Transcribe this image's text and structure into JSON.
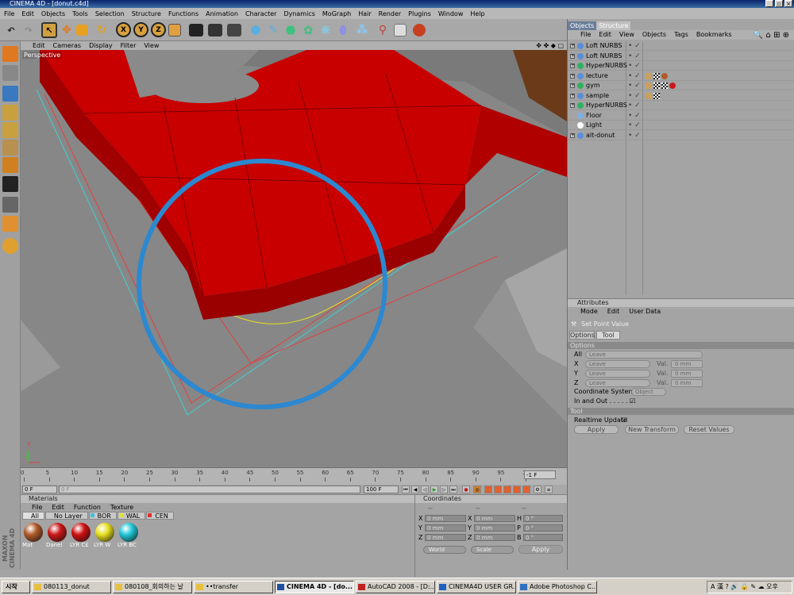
{
  "window": {
    "title": "CINEMA 4D - [donut.c4d]"
  },
  "menu": [
    "File",
    "Edit",
    "Objects",
    "Tools",
    "Selection",
    "Structure",
    "Functions",
    "Animation",
    "Character",
    "Dynamics",
    "MoGraph",
    "Hair",
    "Render",
    "Plugins",
    "Window",
    "Help"
  ],
  "toolbar": {
    "x_label": "X",
    "y_label": "Y",
    "z_label": "Z"
  },
  "viewport": {
    "menu": [
      "Edit",
      "Cameras",
      "Display",
      "Filter",
      "View"
    ],
    "label": "Perspective",
    "icons": "✥ ✤ ◆ ▢"
  },
  "timeline": {
    "ticks": [
      "0",
      "5",
      "10",
      "15",
      "20",
      "25",
      "30",
      "35",
      "40",
      "45",
      "50",
      "55",
      "60",
      "65",
      "70",
      "75",
      "80",
      "85",
      "90",
      "95",
      "100"
    ],
    "end_label": "-1 F",
    "start_field": "0 F",
    "current_field": "0 F",
    "max_field": "100 F",
    "end_field": "100 F"
  },
  "materials": {
    "title": "Materials",
    "menu": [
      "File",
      "Edit",
      "Function",
      "Texture"
    ],
    "tabs": [
      {
        "label": "All",
        "color": ""
      },
      {
        "label": "No Layer",
        "color": ""
      },
      {
        "label": "BOR",
        "color": "#40c0e0"
      },
      {
        "label": "WAL",
        "color": "#e0e040"
      },
      {
        "label": "CEN",
        "color": "#e03030"
      }
    ],
    "items": [
      {
        "label": "Mat",
        "color": "#b05a28"
      },
      {
        "label": "Danel",
        "color": "#cc1818"
      },
      {
        "label": "LYR C£",
        "color": "#d01010"
      },
      {
        "label": "LYR W",
        "color": "#e8e020"
      },
      {
        "label": "LYR BC",
        "color": "#20c8d8"
      }
    ]
  },
  "coordinates": {
    "title": "Coordinates",
    "headers": [
      "--",
      "--",
      "--"
    ],
    "rows": [
      {
        "axis": "X",
        "pos": "0 mm",
        "size_axis": "X",
        "size": "0 mm",
        "rot_axis": "H",
        "rot": "0 °"
      },
      {
        "axis": "Y",
        "pos": "0 mm",
        "size_axis": "Y",
        "size": "0 mm",
        "rot_axis": "P",
        "rot": "0 °"
      },
      {
        "axis": "Z",
        "pos": "0 mm",
        "size_axis": "Z",
        "size": "0 mm",
        "rot_axis": "B",
        "rot": "0 °"
      }
    ],
    "mode1": "World",
    "mode2": "Scale",
    "apply": "Apply"
  },
  "objects": {
    "tabs": [
      "Objects",
      "Structure"
    ],
    "menu": [
      "File",
      "Edit",
      "View",
      "Objects",
      "Tags",
      "Bookmarks"
    ],
    "icons": "🔍 ⌂ ⊞ ⊕",
    "rows": [
      {
        "name": "Loft NURBS",
        "icon": "#5b8dd8",
        "exp": "+",
        "tags": []
      },
      {
        "name": "Loft NURBS",
        "icon": "#5b8dd8",
        "exp": "+",
        "tags": []
      },
      {
        "name": "HyperNURBS",
        "icon": "#30b060",
        "exp": "+",
        "tags": []
      },
      {
        "name": "lecture",
        "icon": "#5b8dd8",
        "exp": "+",
        "tags": [
          "ph",
          "tex",
          "mat:#b05a28"
        ]
      },
      {
        "name": "gym",
        "icon": "#30b060",
        "exp": "+",
        "tags": [
          "ph",
          "tex",
          "tex",
          "mat:#cc1818"
        ]
      },
      {
        "name": "sample",
        "icon": "#5b8dd8",
        "exp": "+",
        "tags": [
          "ph",
          "tex"
        ]
      },
      {
        "name": "HyperNURBS",
        "icon": "#30b060",
        "exp": "+",
        "tags": []
      },
      {
        "name": "Floor",
        "icon": "#7fb0e0",
        "exp": "",
        "tags": []
      },
      {
        "name": "Light",
        "icon": "#ffffff",
        "exp": "",
        "tags": []
      },
      {
        "name": "alt-donut",
        "icon": "#5b8dd8",
        "exp": "+",
        "tags": []
      }
    ]
  },
  "attributes": {
    "title": "Attributes",
    "menu": [
      "Mode",
      "Edit",
      "User Data"
    ],
    "tool_name": "Set Point Value",
    "tabs": [
      "Options",
      "Tool"
    ],
    "options_header": "Options",
    "all_label": "All",
    "all_value": "Leave",
    "axes": [
      {
        "axis": "X",
        "mode": "Leave",
        "val_label": "Val.",
        "val": "0 mm"
      },
      {
        "axis": "Y",
        "mode": "Leave",
        "val_label": "Val.",
        "val": "0 mm"
      },
      {
        "axis": "Z",
        "mode": "Leave",
        "val_label": "Val.",
        "val": "0 mm"
      }
    ],
    "coord_label": "Coordinate System",
    "coord_value": "Object",
    "inout_label": "In and Out . . . . . . .",
    "tool_header": "Tool",
    "realtime_label": "Realtime Update",
    "buttons": [
      "Apply",
      "New Transform",
      "Reset Values"
    ]
  },
  "taskbar": {
    "start": "시작",
    "tasks": [
      {
        "label": "080113_donut",
        "icon": "#e8c040"
      },
      {
        "label": "080108_회의하는 날",
        "icon": "#e8c040"
      },
      {
        "label": "••transfer",
        "icon": "#e8c040"
      },
      {
        "label": "CINEMA 4D - [do...",
        "icon": "#2050a0"
      },
      {
        "label": "AutoCAD 2008 - [D:...",
        "icon": "#c02020"
      },
      {
        "label": "CINEMA4D USER GR...",
        "icon": "#2060c0"
      },
      {
        "label": "Adobe Photoshop C...",
        "icon": "#3070c0"
      }
    ],
    "tray": "A 漢 ? 🔊 🔒 ✎ ☁ 오후 7:57"
  },
  "brand": "MAXON CINEMA 4D"
}
